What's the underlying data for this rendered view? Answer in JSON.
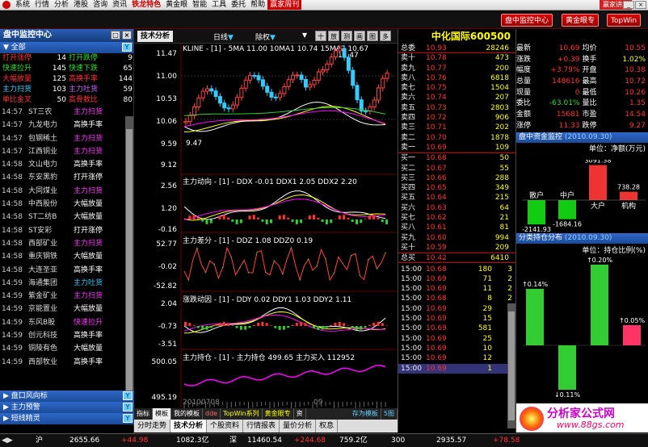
{
  "menu": {
    "items": [
      "系统",
      "行情",
      "分析",
      "港股",
      "咨询",
      "资讯",
      "铁龙特色",
      "黄金眼",
      "智能",
      "工具",
      "委托",
      "帮助"
    ],
    "highlight": "赢家周刊",
    "vip": "赢家讲坛"
  },
  "toolbar": {
    "buttons": [
      "盘中监控中心",
      "黄金眼专",
      "TopWin"
    ]
  },
  "left": {
    "title": "盘中监控中心",
    "all": "全部",
    "stats": [
      [
        "打开涨停",
        "14",
        "打开跌停",
        "9"
      ],
      [
        "快速拉升",
        "145",
        "快速下跌",
        "65"
      ],
      [
        "大幅放量",
        "125",
        "高换手率",
        "144"
      ],
      [
        "主力扫货",
        "103",
        "主力吐货",
        "59"
      ],
      [
        "单比金叉",
        "50",
        "高骨数比",
        "80"
      ]
    ],
    "rows": [
      [
        "14:57",
        "ST三农",
        "主力扫货",
        "p"
      ],
      [
        "14:57",
        "九龙电力",
        "高换手率",
        "w"
      ],
      [
        "14:57",
        "包钢稀土",
        "主力扫货",
        "p"
      ],
      [
        "14:57",
        "江西铜业",
        "主力扫货",
        "p"
      ],
      [
        "14:58",
        "文山电力",
        "高换手率",
        "w"
      ],
      [
        "14:58",
        "东安黑豹",
        "打开涨停",
        "w"
      ],
      [
        "14:58",
        "大同煤业",
        "主力扫货",
        "p"
      ],
      [
        "14:58",
        "中西股份",
        "大幅放量",
        "w"
      ],
      [
        "14:58",
        "ST二纺B",
        "大幅放量",
        "w"
      ],
      [
        "14:58",
        "ST安彩",
        "打开涨停",
        "w"
      ],
      [
        "14:58",
        "西部矿业",
        "主力扫货",
        "p"
      ],
      [
        "14:58",
        "重庆钢铁",
        "大幅放量",
        "w"
      ],
      [
        "14:58",
        "大连圣亚",
        "高换手率",
        "w"
      ],
      [
        "14:59",
        "海通集团",
        "主力吐货",
        "c"
      ],
      [
        "14:59",
        "紫金矿业",
        "主力扫货",
        "p"
      ],
      [
        "14:59",
        "京能置业",
        "大幅放量",
        "w"
      ],
      [
        "14:59",
        "东风B股",
        "快速拉升",
        "p"
      ],
      [
        "14:59",
        "创元科技",
        "高换手率",
        "w"
      ],
      [
        "14:59",
        "铜陵有色",
        "大幅放量",
        "w"
      ],
      [
        "14:59",
        "西部牧业",
        "高换手率",
        "w"
      ]
    ],
    "sections": [
      "盘口风向标",
      "主力预警",
      "短线精灵"
    ]
  },
  "chart": {
    "tab": "技术分析",
    "period": "日线",
    "adjust": "除权",
    "icons": [
      "十字",
      "放",
      "测",
      "画",
      "图",
      "多"
    ],
    "kline_label": "KLINE - [1] - 5MA 11.00 10MA1 10.74 15MA2 10.67",
    "kline_y": [
      "11.47",
      "11.00",
      "10.53",
      "10.06",
      "9.59",
      "9.12"
    ],
    "high_mark": "11.47",
    "low_mark": "9.47",
    "ddx_label": "主力动向 - [1] - DDX -0.01 DDX1 2.05 DDX2 2.20",
    "ddx_y": [
      "2.56",
      "1.20",
      "-0.16"
    ],
    "ddz_label": "主力差分 - [1] - DDZ 1.08 DDZ0 0.19",
    "ddz_y": [
      "52.77",
      "-0.02",
      "-52.82"
    ],
    "ddy_label": "涨跌动因 - [1] - DDY 0.02 DDY1 1.03 DDY2 1.11",
    "ddy_y": [
      "2.04",
      "-0.73",
      "-3.51"
    ],
    "hold_label": "主力持仓 - [1] - 主力持仓 499.65 主力买入 112952",
    "hold_y": [
      "500.05",
      "495.19"
    ],
    "date": "20100708",
    "date2": "09",
    "btabs": [
      "指标",
      "模板",
      "我的模板",
      "dde",
      "TopWin系列",
      "黄金眼专",
      "资"
    ],
    "btabs_right": [
      "存为模板",
      "5图"
    ],
    "btabs2": [
      "分时走势",
      "技术分析",
      "个股资料",
      "行情报表",
      "量价分析",
      "权息"
    ]
  },
  "quote": {
    "title": "中化国际600500",
    "wei_bi": [
      "总委",
      "10.93",
      "28246"
    ],
    "sells": [
      [
        "卖十",
        "10.78",
        "473"
      ],
      [
        "卖九",
        "10.77",
        "200"
      ],
      [
        "卖八",
        "10.76",
        "6818"
      ],
      [
        "卖七",
        "10.75",
        "1504"
      ],
      [
        "卖六",
        "10.74",
        "207"
      ],
      [
        "卖五",
        "10.73",
        "2803"
      ],
      [
        "卖四",
        "10.72",
        "906"
      ],
      [
        "卖三",
        "10.71",
        "202"
      ],
      [
        "卖二",
        "10.70",
        "1878"
      ],
      [
        "卖一",
        "10.69",
        "109"
      ]
    ],
    "buys": [
      [
        "买一",
        "10.68",
        "50"
      ],
      [
        "买二",
        "10.67",
        "55"
      ],
      [
        "买三",
        "10.66",
        "288"
      ],
      [
        "买四",
        "10.65",
        "349"
      ],
      [
        "买五",
        "10.64",
        "215"
      ],
      [
        "买六",
        "10.63",
        "64"
      ],
      [
        "买七",
        "10.62",
        "21"
      ],
      [
        "买八",
        "10.61",
        "81"
      ],
      [
        "买九",
        "10.60",
        "994"
      ],
      [
        "买十",
        "10.59",
        "209"
      ]
    ],
    "total_buy": [
      "总买",
      "10.42",
      "6410"
    ],
    "ticks": [
      [
        "15:00",
        "10.68",
        "180",
        "3"
      ],
      [
        "15:00",
        "10.69",
        "71",
        "2"
      ],
      [
        "15:00",
        "10.69",
        "11",
        "2"
      ],
      [
        "15:00",
        "10.68",
        "8",
        "2"
      ],
      [
        "15:00",
        "10.69",
        "29",
        "6"
      ],
      [
        "15:00",
        "10.69",
        "15",
        "3"
      ],
      [
        "15:00",
        "10.69",
        "581",
        "5"
      ],
      [
        "15:00",
        "10.69",
        "25",
        "3"
      ],
      [
        "15:00",
        "10.69",
        "10",
        "3"
      ],
      [
        "15:00",
        "10.69",
        "12",
        "3"
      ],
      [
        "15:00",
        "10.69",
        "1",
        "1"
      ]
    ]
  },
  "right": {
    "stats": [
      [
        "最新",
        "10.69",
        "均价",
        "10.55"
      ],
      [
        "涨跌",
        "+0.39",
        "换手",
        "1.02%"
      ],
      [
        "幅度",
        "+3.79%",
        "开盘",
        "10.38"
      ],
      [
        "总量",
        "148616",
        "最高",
        "10.72"
      ],
      [
        "现量",
        "0",
        "最低",
        "10.26"
      ],
      [
        "委比",
        "-63.01%",
        "量比",
        "1.35"
      ],
      [
        "金额",
        "15681",
        "市盈",
        "14.54"
      ],
      [
        "涨停",
        "11.33",
        "跌停",
        "9.27"
      ]
    ],
    "money_title": "盘中资金监控",
    "money_date": "(2010.09.30)",
    "money_unit": "单位：净额(万元)",
    "money_bars": [
      {
        "name": "散户",
        "value": -2141.93
      },
      {
        "name": "中户",
        "value": -1684.16
      },
      {
        "name": "大户",
        "value": 3091.38
      },
      {
        "name": "机构",
        "value": 738.28
      }
    ],
    "hold_title": "分类持仓分布",
    "hold_date": "(2010.09.30)",
    "hold_unit": "单位：持仓比例(%)",
    "hold_bars": [
      {
        "label": "0.14%",
        "value": 0.14
      },
      {
        "label": "0.11%",
        "value": -0.11
      },
      {
        "label": "0.20%",
        "value": 0.2
      },
      {
        "label": "0.05%",
        "value": 0.05
      }
    ],
    "brand": "分析家公式网",
    "url": "www.88gs.com"
  },
  "status": {
    "items": [
      [
        "沪",
        "2655.66",
        "+44.98",
        "1082.3亿"
      ],
      [
        "深",
        "11460.54",
        "+244.68",
        "759.2亿"
      ],
      [
        "300",
        "2935.57",
        "+78.58",
        "..."
      ]
    ]
  }
}
